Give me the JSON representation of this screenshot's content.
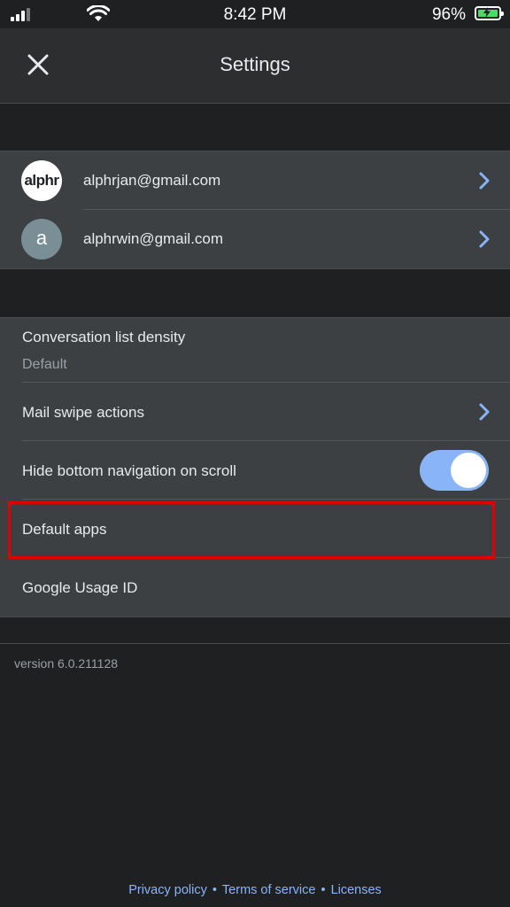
{
  "status_bar": {
    "time": "8:42 PM",
    "battery_percent": "96%",
    "battery_color": "#4cd964"
  },
  "app_bar": {
    "title": "Settings",
    "close_icon": "close-icon"
  },
  "accounts": [
    {
      "avatar_text": "alphr",
      "email": "alphrjan@gmail.com"
    },
    {
      "avatar_text": "a",
      "email": "alphrwin@gmail.com"
    }
  ],
  "settings": {
    "density_label": "Conversation list density",
    "density_value": "Default",
    "swipe_label": "Mail swipe actions",
    "hide_nav_label": "Hide bottom navigation on scroll",
    "hide_nav_on": true,
    "default_apps_label": "Default apps",
    "usage_id_label": "Google Usage ID"
  },
  "version": "version 6.0.211128",
  "footer": {
    "privacy": "Privacy policy",
    "terms": "Terms of service",
    "licenses": "Licenses",
    "separator": "•"
  },
  "colors": {
    "accent": "#8ab4f8",
    "highlight": "#e00000",
    "background": "#1f2022",
    "surface": "#3c4043"
  }
}
